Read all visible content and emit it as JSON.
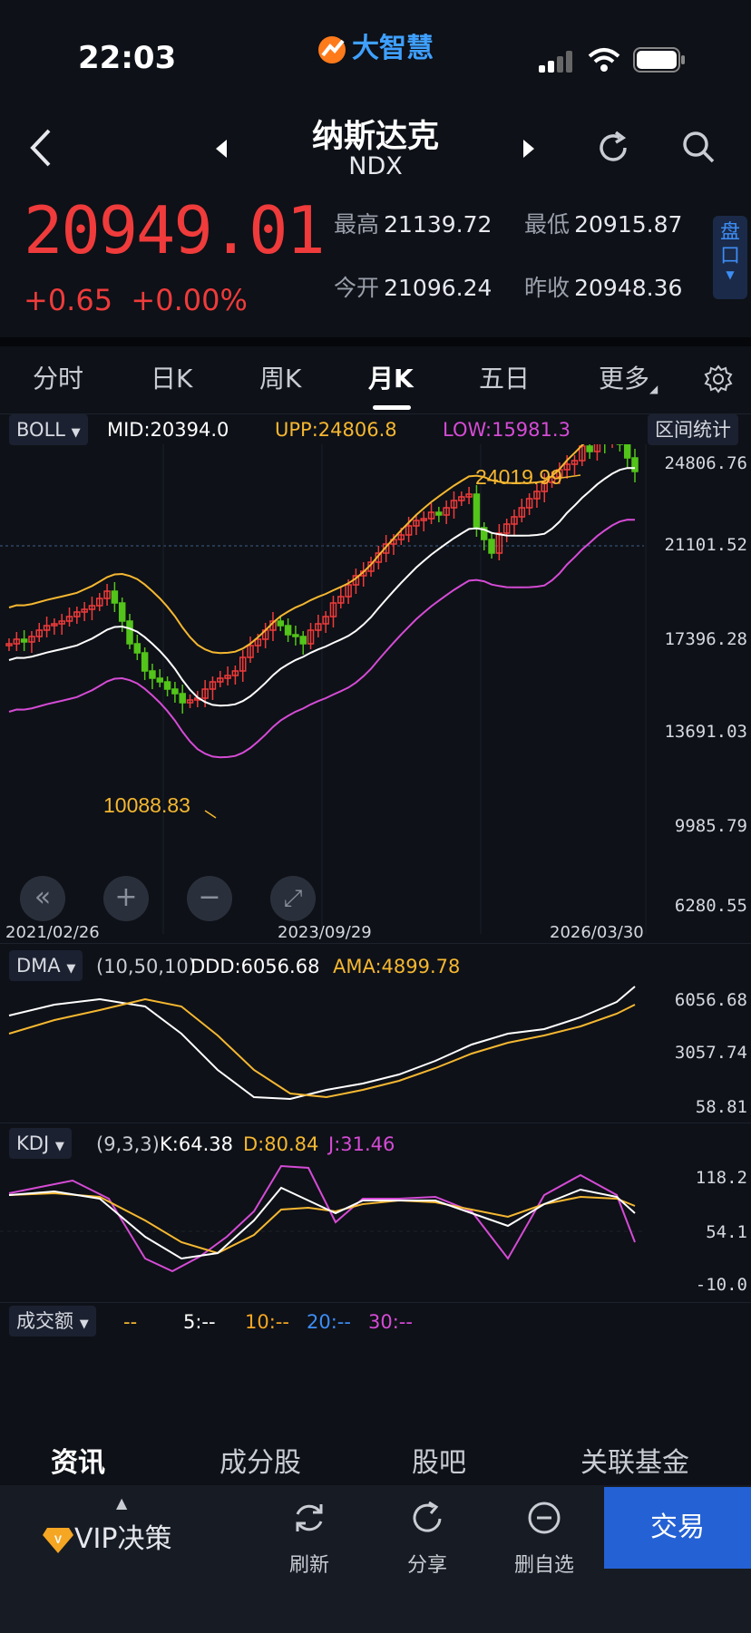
{
  "status": {
    "time": "22:03"
  },
  "brand": {
    "name": "大智慧"
  },
  "header": {
    "title": "纳斯达克",
    "symbol": "NDX"
  },
  "quote": {
    "price": "20949.01",
    "change": "+0.65",
    "change_pct": "+0.00%",
    "high_label": "最高",
    "high": "21139.72",
    "low_label": "最低",
    "low": "20915.87",
    "open_label": "今开",
    "open": "21096.24",
    "prev_label": "昨收",
    "prev": "20948.36",
    "pankou": "盘口"
  },
  "tabs": [
    "分时",
    "日K",
    "周K",
    "月K",
    "五日",
    "更多"
  ],
  "main_chart": {
    "indicator": "BOLL",
    "mid": "MID:20394.0",
    "upp": "UPP:24806.8",
    "low": "LOW:15981.3",
    "range_stats": "区间统计",
    "y_ticks": [
      "24806.76",
      "21101.52",
      "17396.28",
      "13691.03",
      "9985.79",
      "6280.55"
    ],
    "dates": [
      "2021/02/26",
      "2023/09/29",
      "2026/03/30"
    ],
    "max_label": "24019.99",
    "min_label": "10088.83",
    "colors": {
      "up": "#ef3b3b",
      "down": "#52c41a",
      "upper": "#f5b731",
      "mid": "#ffffff",
      "lower": "#d54bd6"
    }
  },
  "dma": {
    "indicator": "DMA",
    "params": "(10,50,10)",
    "ddd": "DDD:6056.68",
    "ama": "AMA:4899.78",
    "y_ticks": [
      "6056.68",
      "3057.74",
      "58.81"
    ]
  },
  "kdj": {
    "indicator": "KDJ",
    "params": "(9,3,3)",
    "k": "K:64.38",
    "d": "D:80.84",
    "j": "J:31.46",
    "y_ticks": [
      "118.2",
      "54.1",
      "-10.0"
    ]
  },
  "volume": {
    "indicator": "成交额",
    "vals": [
      "--",
      "5:--",
      "10:--",
      "20:--",
      "30:--"
    ]
  },
  "bottom_tabs": [
    "资讯",
    "成分股",
    "股吧",
    "关联基金"
  ],
  "actions": {
    "vip": "VIP决策",
    "refresh": "刷新",
    "share": "分享",
    "remove_watch": "删自选",
    "trade": "交易"
  }
}
